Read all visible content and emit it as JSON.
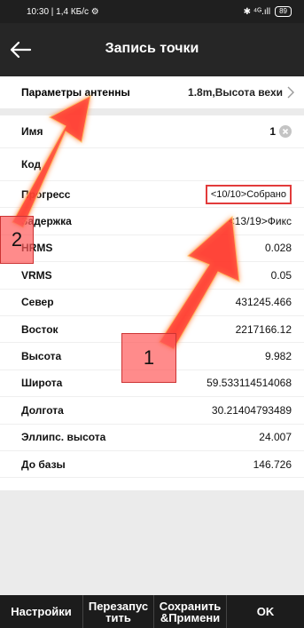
{
  "status_bar": {
    "time_speed": "10:30 | 1,4 КБ/с ⚙",
    "signal": "✱ ⁴ᴳ.ıll",
    "battery": "89"
  },
  "app_bar": {
    "title": "Запись точки",
    "back_icon": "arrow-left-icon"
  },
  "antenna": {
    "label": "Параметры антенны",
    "value": "1.8m,Высота вехи"
  },
  "fields": [
    {
      "label": "Имя",
      "value": "1"
    },
    {
      "label": "Код",
      "value": ""
    },
    {
      "label": "Прогресс",
      "value": "<10/10>Собрано"
    },
    {
      "label": "Задержка",
      "value": "<13/19>Фикс"
    },
    {
      "label": "HRMS",
      "value": "0.028"
    },
    {
      "label": "VRMS",
      "value": "0.05"
    },
    {
      "label": "Север",
      "value": "431245.466"
    },
    {
      "label": "Восток",
      "value": "2217166.12"
    },
    {
      "label": "Высота",
      "value": "9.982"
    },
    {
      "label": "Широта",
      "value": "59.533114514068"
    },
    {
      "label": "Долгота",
      "value": "30.21404793489"
    },
    {
      "label": "Эллипс. высота",
      "value": "24.007"
    },
    {
      "label": "До базы",
      "value": "146.726"
    }
  ],
  "buttons": {
    "settings": "Настройки",
    "restart_1": "Перезапус",
    "restart_2": "тить",
    "save_1": "Сохранить",
    "save_2": "&Примени",
    "ok": "OK"
  },
  "annotations": {
    "marker1": "1",
    "marker2": "2"
  },
  "colors": {
    "appbar": "#262626",
    "highlight": "#e23b3b",
    "arrow": "#ff4b2b"
  }
}
